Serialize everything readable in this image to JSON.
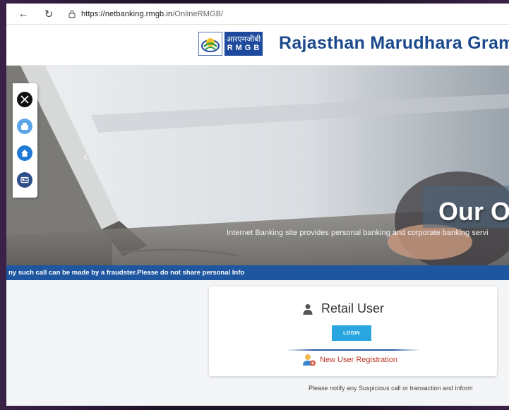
{
  "browser": {
    "url_domain": "https://netbanking.rmgb.in",
    "url_path": "/OnlineRMGB/"
  },
  "header": {
    "logo_hindi": "आरएमजीबी",
    "logo_abbr": "RMGB",
    "bank_name": "Rajasthan Marudhara Gramin"
  },
  "hero": {
    "title": "Our Ob",
    "subtitle": "Internet Banking site provides personal banking and corporate banking servi",
    "prev_icon": "chevron-left-icon"
  },
  "social": {
    "items": [
      {
        "name": "x",
        "icon": "x-logo-icon",
        "color": "#111111"
      },
      {
        "name": "youtube",
        "icon": "youtube-icon",
        "color": "#5aa6e6"
      },
      {
        "name": "home",
        "icon": "home-icon",
        "color": "#1f7ad6"
      },
      {
        "name": "contact",
        "icon": "id-card-icon",
        "color": "#2e4f8a"
      }
    ]
  },
  "marquee": {
    "text": "ny such call can be made by a fraudster.Please do not share personal Info"
  },
  "login_card": {
    "title": "Retail User",
    "login_label": "LOGIN",
    "register_label": "New User Registration"
  },
  "notice": "Please notify any Suspicious call or transaction and inform",
  "colors": {
    "brand_blue": "#1d4a8c",
    "marquee_bg": "#1e56a0",
    "login_btn": "#29a6e0",
    "register_text": "#c0392b"
  }
}
